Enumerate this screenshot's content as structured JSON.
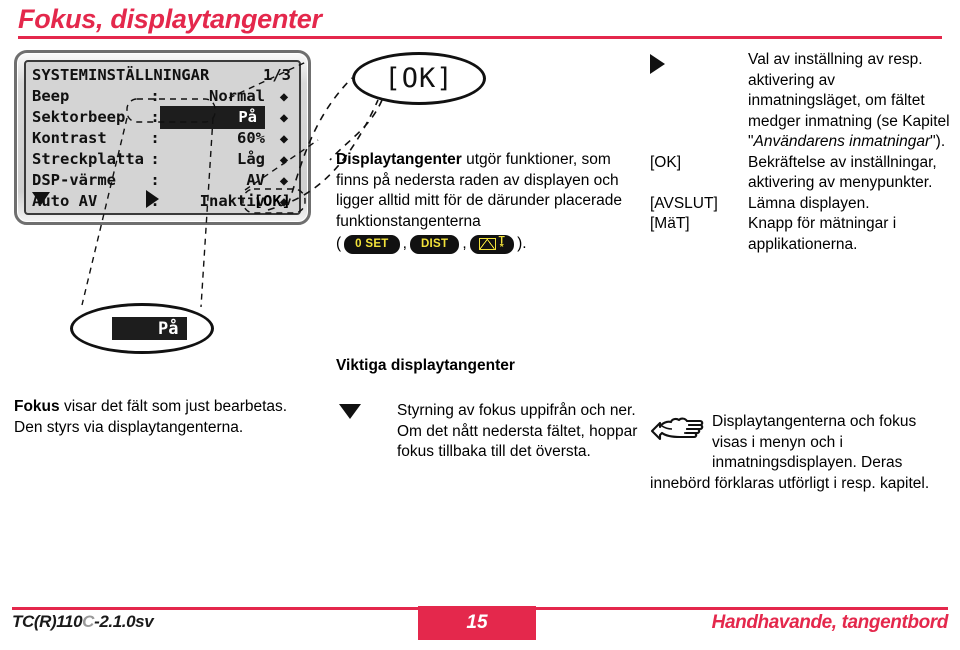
{
  "header": {
    "title": "Fokus, displaytangenter",
    "accent_color": "#E4284C"
  },
  "lcd": {
    "screen_title": "SYSTEMINSTÄLLNINGAR",
    "page_indicator": "1/3",
    "rows": [
      {
        "label": "Beep",
        "colon": ":",
        "value": "Normal",
        "highlighted": false,
        "arrow": "left-right-arrow"
      },
      {
        "label": "Sektorbeep",
        "colon": ":",
        "value": "På",
        "highlighted": true,
        "arrow": "left-right-arrow"
      },
      {
        "label": "Kontrast",
        "colon": ":",
        "value": "60%",
        "highlighted": false,
        "arrow": "left-right-arrow"
      },
      {
        "label": "Streckplatta",
        "colon": ":",
        "value": "Låg",
        "highlighted": false,
        "arrow": "left-right-arrow"
      },
      {
        "label": "DSP-värme",
        "colon": ":",
        "value": "AV",
        "highlighted": false,
        "arrow": "left-right-arrow"
      },
      {
        "label": "Auto AV",
        "colon": ":",
        "value": "Inaktiv",
        "highlighted": false,
        "arrow": "left-right-arrow"
      }
    ],
    "softkeys": {
      "left": "down-triangle-icon",
      "middle": "right-triangle-icon",
      "right": "[OK]"
    }
  },
  "callouts": {
    "ok_label": "[OK]",
    "focus_chip": "På"
  },
  "middle": {
    "para_bold": "Displaytangenter",
    "para_rest": " utgör funktioner, som finns på nedersta raden av displayen och ligger alltid mitt för de därunder placerade funktionstangenterna",
    "keys_prefix": "(",
    "keys": [
      {
        "id": "zero-set-key",
        "label": "0 SET"
      },
      {
        "id": "dist-key",
        "label": "DIST"
      },
      {
        "id": "envelope-target-key",
        "label": "",
        "icons": [
          "envelope-icon",
          "t-star-icon"
        ]
      }
    ],
    "keys_separator": ",",
    "keys_suffix": ").",
    "subheading": "Viktiga displaytangenter",
    "down_arrow_icon": "down-triangle-icon",
    "down_arrow_text": "Styrning av fokus uppifrån och ner. Om det nått nedersta fältet, hoppar fokus tillbaka till det översta."
  },
  "left": {
    "para_bold": "Fokus",
    "para_rest": " visar det fält som just bearbetas. Den styrs via displaytangenterna."
  },
  "right": {
    "rows": [
      {
        "key_icon": "right-triangle-icon",
        "key": "",
        "text_pre": "Val av inställning av resp. aktivering av inmatningsläget, om fältet medger inmatning (se Kapitel \"",
        "text_italic": "Användarens inmatningar",
        "text_post": "\")."
      },
      {
        "key_icon": "",
        "key": "[OK]",
        "text_pre": "Bekräftelse av inställningar, aktivering av menypunkter.",
        "text_italic": "",
        "text_post": ""
      },
      {
        "key_icon": "",
        "key": "[AVSLUT]",
        "text_pre": "Lämna displayen.",
        "text_italic": "",
        "text_post": ""
      },
      {
        "key_icon": "",
        "key": "[MäT]",
        "text_pre": "Knapp för mätningar i applikationerna.",
        "text_italic": "",
        "text_post": ""
      }
    ],
    "note_icon": "pointing-hand-icon",
    "note_text": "Displaytangenterna och fokus visas i menyn och i inmatningsdisplayen. Deras innebörd förklaras utförligt i resp. kapitel."
  },
  "footer": {
    "left_pre": "TC(R)110",
    "left_outline_char": "C",
    "left_post": "-2.1.0sv",
    "page_number": "15",
    "right": "Handhavande, tangentbord"
  }
}
